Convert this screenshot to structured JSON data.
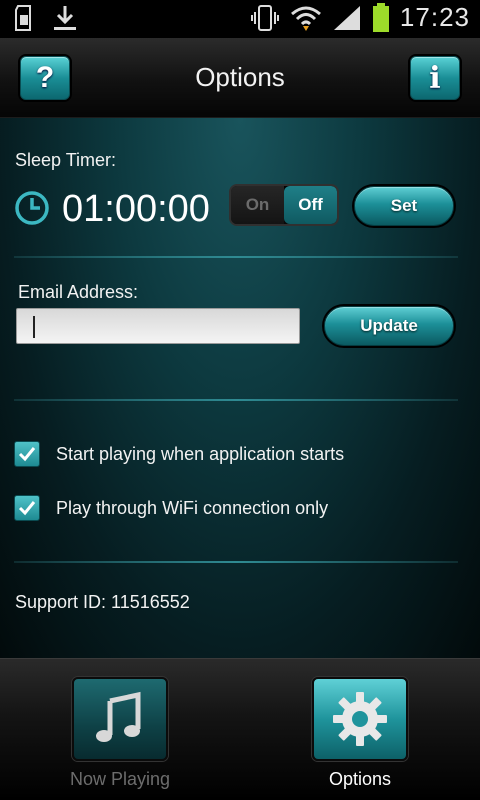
{
  "statusbar": {
    "time": "17:23",
    "icons": [
      "sd-card-icon",
      "download-icon",
      "vibrate-icon",
      "wifi-icon",
      "signal-icon",
      "battery-icon"
    ]
  },
  "header": {
    "title": "Options",
    "help_label": "?",
    "info_label": "i"
  },
  "sleep_timer": {
    "label": "Sleep Timer:",
    "value": "01:00:00",
    "toggle_on": "On",
    "toggle_off": "Off",
    "toggle_selected": "Off",
    "set_label": "Set"
  },
  "email": {
    "label": "Email Address:",
    "value": "",
    "update_label": "Update"
  },
  "options": [
    {
      "label": "Start playing when application starts",
      "checked": true
    },
    {
      "label": "Play through WiFi connection only",
      "checked": true
    }
  ],
  "support": {
    "text": "Support ID: 11516552"
  },
  "tabs": [
    {
      "label": "Now Playing",
      "icon": "music-note-icon",
      "active": false
    },
    {
      "label": "Options",
      "icon": "gear-icon",
      "active": true
    }
  ],
  "colors": {
    "accent": "#1f949c",
    "accent_light": "#5fd0d6",
    "panel_bg": "#0d3a40"
  }
}
